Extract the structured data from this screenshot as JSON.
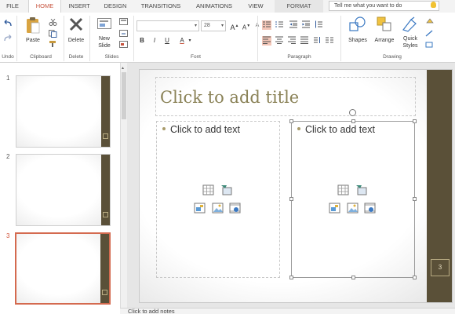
{
  "tabs": [
    {
      "label": "FILE"
    },
    {
      "label": "HOME"
    },
    {
      "label": "INSERT"
    },
    {
      "label": "DESIGN"
    },
    {
      "label": "TRANSITIONS"
    },
    {
      "label": "ANIMATIONS"
    },
    {
      "label": "VIEW"
    },
    {
      "label": "FORMAT"
    }
  ],
  "tellme": {
    "placeholder": "Tell me what you want to do"
  },
  "ribbon": {
    "groups": {
      "undo": "Undo",
      "clipboard": "Clipboard",
      "delete": "Delete",
      "slides": "Slides",
      "font": "Font",
      "paragraph": "Paragraph",
      "drawing": "Drawing"
    },
    "buttons": {
      "paste": "Paste",
      "delete": "Delete",
      "new_slide_1": "New",
      "new_slide_2": "Slide",
      "shapes": "Shapes",
      "arrange": "Arrange",
      "quick_styles_1": "Quick",
      "quick_styles_2": "Styles"
    },
    "font_name": "",
    "font_size": "28",
    "bold": "B",
    "italic": "I",
    "underline": "U",
    "font_color": "A"
  },
  "slides": [
    {
      "number": "1"
    },
    {
      "number": "2"
    },
    {
      "number": "3"
    }
  ],
  "slide": {
    "title_placeholder": "Click to add title",
    "left_placeholder": "Click to add text",
    "right_placeholder": "Click to add text",
    "slide_number": "3"
  },
  "notes": {
    "placeholder": "Click to add notes"
  },
  "colors": {
    "accent": "#c7533d",
    "sidebar": "#5a5038",
    "title": "#8a8257"
  }
}
